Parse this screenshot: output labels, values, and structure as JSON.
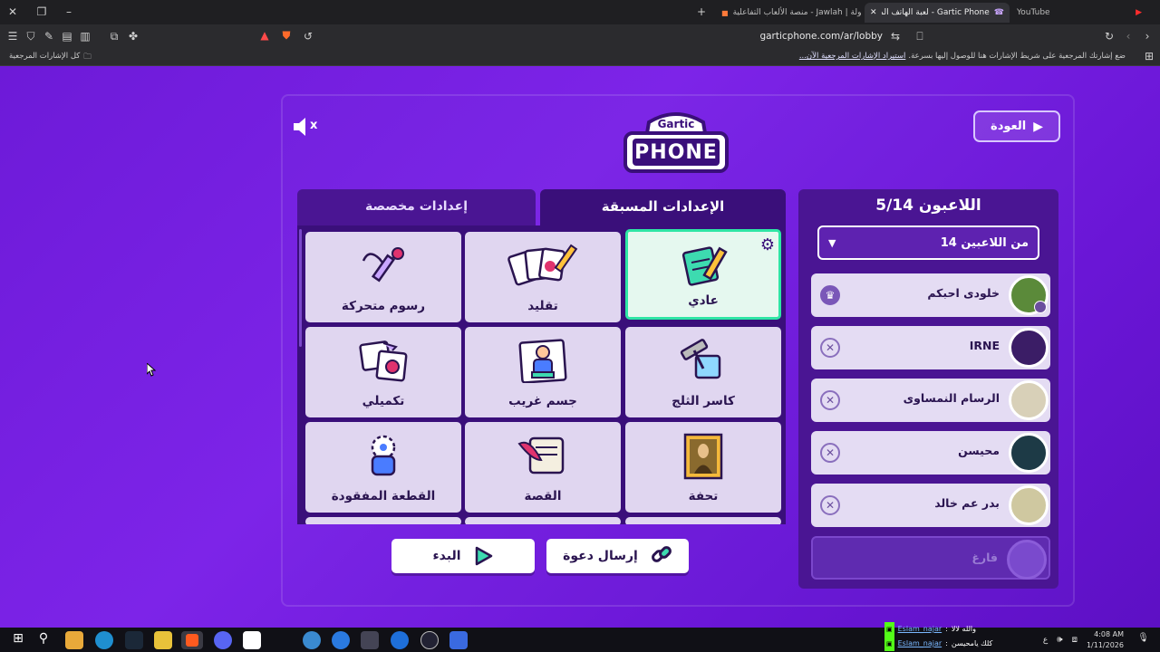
{
  "browser": {
    "tabs": [
      {
        "label": "YouTube"
      },
      {
        "label": "Gartic Phone - لعبة الهاتف المكسور"
      },
      {
        "label": "جولة | Jawlah - منصة الألعاب التفاعلية"
      }
    ],
    "url": "garticphone.com/ar/lobby",
    "bookmark_hint": "ضع إشارتك المرجعية على شريط الإشارات هنا للوصول إليها بسرعة.",
    "bookmark_import": "استيراد الإشارات المرجعية الآن...",
    "bookmark_all": "كل الإشارات المرجعية"
  },
  "game": {
    "back_label": "العودة",
    "logo_small": "Gartic",
    "logo_big": "PHONE",
    "mute_mark": "x",
    "tabs": {
      "preset": "الإعدادات المسبقة",
      "custom": "إعدادات مخصصة"
    },
    "modes": [
      {
        "label": "عادي",
        "icon": "notepad-pencil-icon",
        "selected": true
      },
      {
        "label": "تقليد",
        "icon": "cards-pencil-icon"
      },
      {
        "label": "رسوم متحركة",
        "icon": "pencil-swirl-icon"
      },
      {
        "label": "كاسر الثلج",
        "icon": "icebreaker-icon"
      },
      {
        "label": "جسم غريب",
        "icon": "odd-body-icon"
      },
      {
        "label": "تكميلي",
        "icon": "complement-icon"
      },
      {
        "label": "تحفة",
        "icon": "mona-lisa-icon"
      },
      {
        "label": "القصة",
        "icon": "scroll-quill-icon"
      },
      {
        "label": "القطعة المفقودة",
        "icon": "missing-piece-icon"
      }
    ],
    "start_label": "البدء",
    "invite_label": "إرسال دعوة",
    "players": {
      "title": "اللاعبون 5/14",
      "limit_label": "14 من اللاعبين",
      "list": [
        {
          "name": "خلودى احبكم",
          "host": true
        },
        {
          "name": "IRNE"
        },
        {
          "name": "الرسام النمساوى"
        },
        {
          "name": "محيسن"
        },
        {
          "name": "بدر عم خالد"
        }
      ],
      "empty_label": "فارغ"
    }
  },
  "overlay_chat": {
    "line1_user": "Eslam_najar",
    "line1_text": "والله لالا",
    "line2_user": "Eslam_najar",
    "line2_text": "كلك يامحيسن"
  },
  "taskbar": {
    "time": "4:08 AM",
    "date": "1/11/2026",
    "lang": "ع"
  }
}
